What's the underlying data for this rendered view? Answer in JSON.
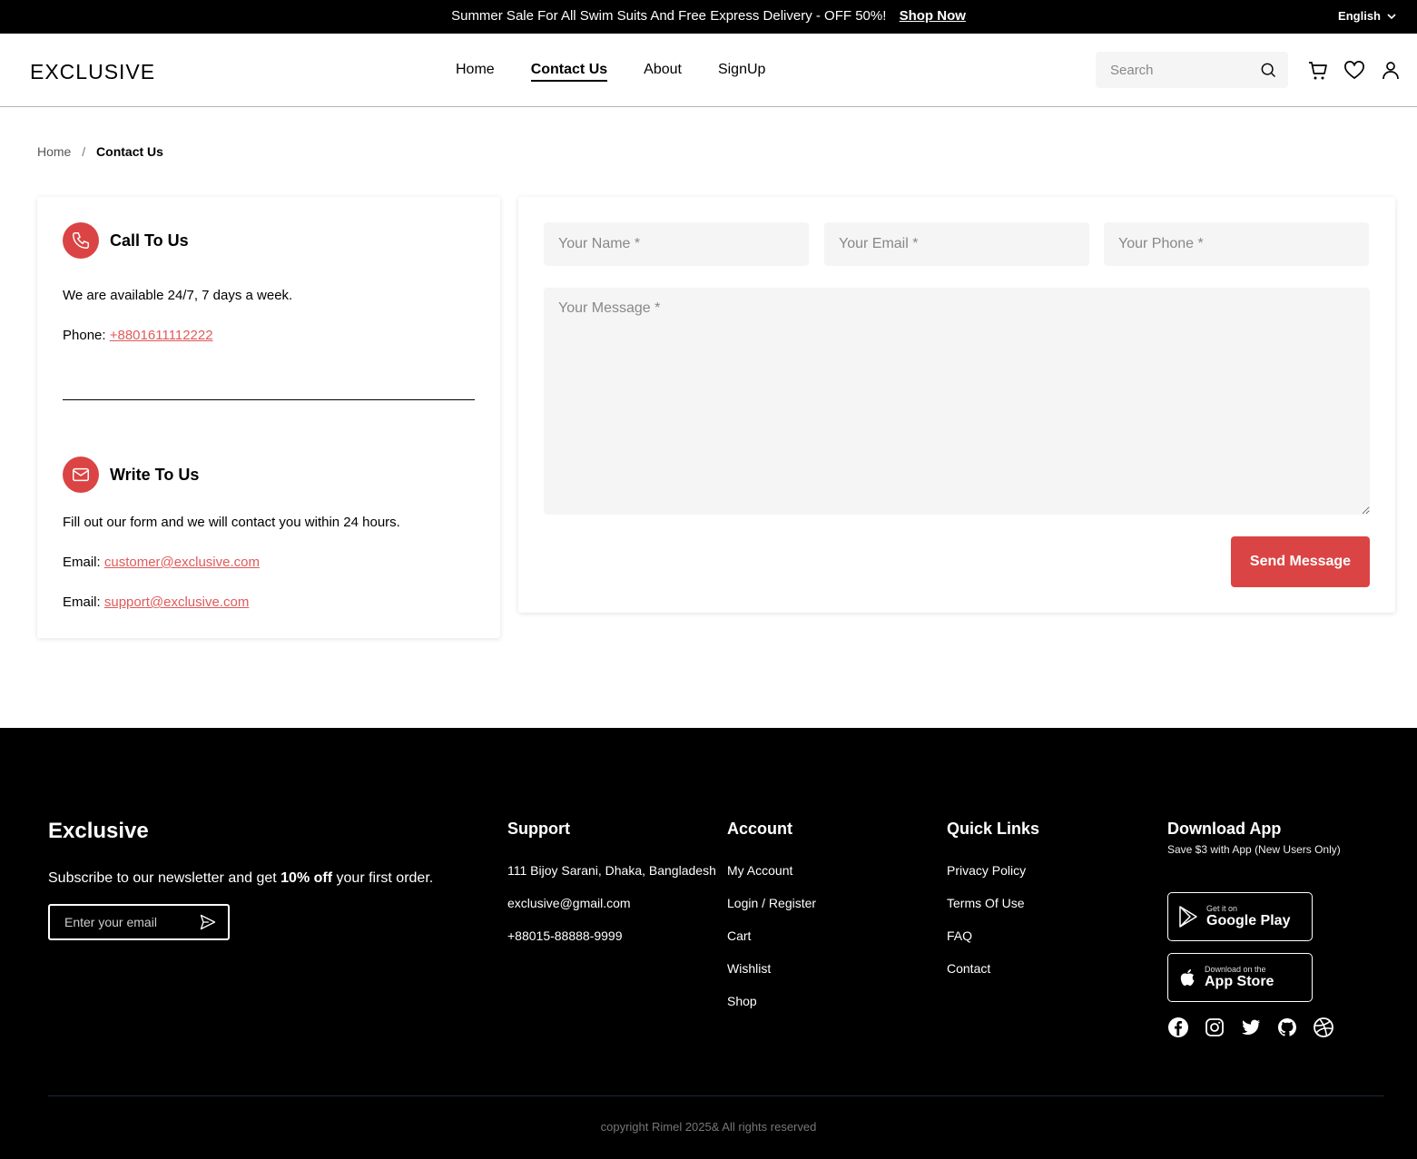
{
  "topbar": {
    "promo": "Summer Sale For All Swim Suits And Free Express Delivery - OFF 50%!",
    "shop_now": "Shop Now",
    "language": "English"
  },
  "header": {
    "logo": "EXCLUSIVE",
    "nav": [
      {
        "label": "Home",
        "active": false
      },
      {
        "label": "Contact Us",
        "active": true
      },
      {
        "label": "About",
        "active": false
      },
      {
        "label": "SignUp",
        "active": false
      }
    ],
    "search_placeholder": "Search",
    "icons": [
      "search-icon",
      "cart-icon",
      "heart-icon",
      "user-icon"
    ]
  },
  "breadcrumb": {
    "home": "Home",
    "separator": "/",
    "current": "Contact Us"
  },
  "contact_info": {
    "call": {
      "title": "Call To Us",
      "availability": "We are available 24/7, 7 days a week.",
      "phone_label": "Phone:",
      "phone": "+8801611112222"
    },
    "write": {
      "title": "Write To Us",
      "description": "Fill out our form and we will contact you within 24 hours.",
      "email_label": "Email:",
      "email1": "customer@exclusive.com",
      "email2": "support@exclusive.com"
    }
  },
  "form": {
    "name_placeholder": "Your Name *",
    "email_placeholder": "Your Email *",
    "phone_placeholder": "Your Phone *",
    "message_placeholder": "Your Message *",
    "submit": "Send Message"
  },
  "footer": {
    "brand": "Exclusive",
    "subscribe_pre": "Subscribe to our newsletter and get",
    "subscribe_bold": "10% off",
    "subscribe_post": "your first order.",
    "email_placeholder": "Enter your email",
    "support": {
      "title": "Support",
      "items": [
        "111 Bijoy Sarani, Dhaka, Bangladesh",
        "exclusive@gmail.com",
        "+88015-88888-9999"
      ]
    },
    "account": {
      "title": "Account",
      "items": [
        "My Account",
        "Login / Register",
        "Cart",
        "Wishlist",
        "Shop"
      ]
    },
    "quick_links": {
      "title": "Quick Links",
      "items": [
        "Privacy Policy",
        "Terms Of Use",
        "FAQ",
        "Contact"
      ]
    },
    "download": {
      "title": "Download App",
      "subtitle": "Save $3 with App (New Users Only)",
      "google_small": "Get it on",
      "google_big": "Google Play",
      "apple_small": "Download on the",
      "apple_big": "App Store"
    },
    "socials": [
      "facebook-icon",
      "instagram-icon",
      "twitter-icon",
      "github-icon",
      "dribbble-icon"
    ],
    "copyright": "copyright Rimel 2025& All rights reserved"
  },
  "colors": {
    "accent": "#db4444",
    "link": "#e05a5a",
    "footer_bg": "#000000",
    "input_bg": "#f5f5f5"
  }
}
